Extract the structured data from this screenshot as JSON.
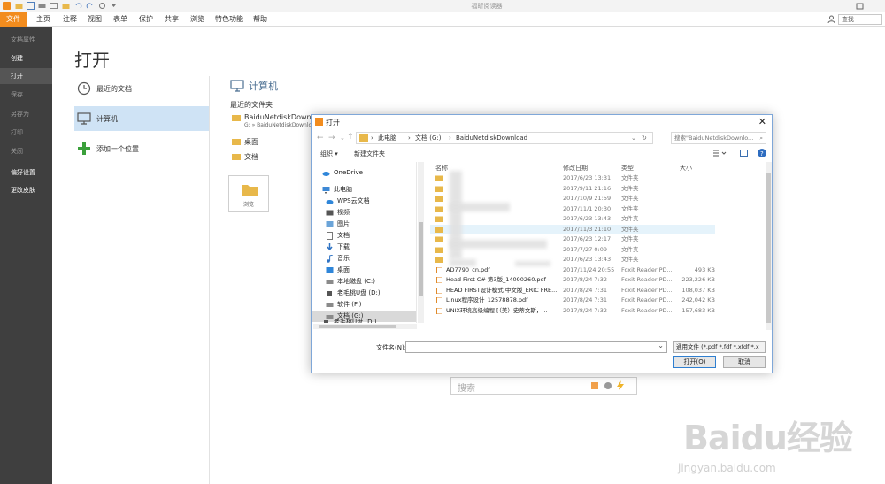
{
  "app": {
    "title": "福昕阅读器",
    "menu": [
      "文件",
      "主页",
      "注释",
      "视图",
      "表单",
      "保护",
      "共享",
      "浏览",
      "特色功能",
      "帮助"
    ],
    "search_placeholder": "查找"
  },
  "sidebar": {
    "items": [
      {
        "label": "文档属性",
        "state": "dim"
      },
      {
        "label": "创建",
        "state": "on"
      },
      {
        "label": "打开",
        "state": "selected"
      },
      {
        "label": "保存",
        "state": "dim"
      },
      {
        "label": "另存为",
        "state": "dim"
      },
      {
        "label": "打印",
        "state": "dim"
      },
      {
        "label": "关闭",
        "state": "dim"
      },
      {
        "label": "偏好设置",
        "state": "on"
      },
      {
        "label": "更改皮肤",
        "state": "on"
      }
    ]
  },
  "open_panel": {
    "title": "打开",
    "options": [
      "最近的文档",
      "计算机",
      "添加一个位置"
    ],
    "computer_heading": "计算机",
    "recent_folders_label": "最近的文件夹",
    "folders": [
      {
        "name": "BaiduNetdiskDownload",
        "sub": "G: » BaiduNetdiskDownlo"
      },
      {
        "name": "桌面"
      },
      {
        "name": "文档"
      }
    ],
    "browse_label": "浏览",
    "bottom_search_placeholder": "搜索"
  },
  "dialog": {
    "title": "打开",
    "path": [
      "此电脑",
      "文档 (G:)",
      "BaiduNetdiskDownload"
    ],
    "search_placeholder": "搜索\"BaiduNetdiskDownlo...",
    "toolbar": {
      "organize": "组织 ▾",
      "new_folder": "新建文件夹"
    },
    "nav_tree": [
      {
        "label": "OneDrive",
        "icon": "cloud-icon",
        "indent": 0
      },
      {
        "label": "此电脑",
        "icon": "computer-icon",
        "indent": 0
      },
      {
        "label": "WPS云文档",
        "icon": "cloud-icon",
        "indent": 1
      },
      {
        "label": "视频",
        "icon": "video-icon",
        "indent": 1
      },
      {
        "label": "图片",
        "icon": "image-icon",
        "indent": 1
      },
      {
        "label": "文档",
        "icon": "document-icon",
        "indent": 1
      },
      {
        "label": "下载",
        "icon": "download-icon",
        "indent": 1
      },
      {
        "label": "音乐",
        "icon": "music-icon",
        "indent": 1
      },
      {
        "label": "桌面",
        "icon": "desktop-icon",
        "indent": 1
      },
      {
        "label": "本地磁盘 (C:)",
        "icon": "drive-icon",
        "indent": 1
      },
      {
        "label": "老毛桃U盘 (D:)",
        "icon": "usb-icon",
        "indent": 1
      },
      {
        "label": "软件 (F:)",
        "icon": "drive-icon",
        "indent": 1
      },
      {
        "label": "文档 (G:)",
        "icon": "drive-icon",
        "indent": 1,
        "selected": true
      },
      {
        "label": "老毛桃U盘 (D:)",
        "icon": "usb-icon",
        "indent": 0
      }
    ],
    "columns": [
      "名称",
      "修改日期",
      "类型",
      "大小"
    ],
    "files": [
      {
        "name": "",
        "date": "2017/6/23 13:31",
        "type": "文件夹",
        "size": "",
        "kind": "folder"
      },
      {
        "name": "",
        "date": "2017/9/11 21:16",
        "type": "文件夹",
        "size": "",
        "kind": "folder"
      },
      {
        "name": "",
        "date": "2017/10/9 21:59",
        "type": "文件夹",
        "size": "",
        "kind": "folder"
      },
      {
        "name": "",
        "date": "2017/11/1 20:30",
        "type": "文件夹",
        "size": "",
        "kind": "folder"
      },
      {
        "name": "",
        "date": "2017/6/23 13:43",
        "type": "文件夹",
        "size": "",
        "kind": "folder"
      },
      {
        "name": "",
        "date": "2017/11/3 21:10",
        "type": "文件夹",
        "size": "",
        "kind": "folder",
        "highlight": true
      },
      {
        "name": "",
        "date": "2017/6/23 12:17",
        "type": "文件夹",
        "size": "",
        "kind": "folder"
      },
      {
        "name": "",
        "date": "2017/7/27 0:09",
        "type": "文件夹",
        "size": "",
        "kind": "folder"
      },
      {
        "name": "",
        "date": "2017/6/23 13:43",
        "type": "文件夹",
        "size": "",
        "kind": "folder"
      },
      {
        "name": "AD7790_cn.pdf",
        "date": "2017/11/24 20:55",
        "type": "Foxit Reader PD...",
        "size": "493 KB",
        "kind": "pdf"
      },
      {
        "name": "Head First C# 第3版_14090260.pdf",
        "date": "2017/8/24 7:32",
        "type": "Foxit Reader PD...",
        "size": "223,226 KB",
        "kind": "pdf"
      },
      {
        "name": "HEAD FIRST设计模式 中文版_ERIC FRE...",
        "date": "2017/8/24 7:31",
        "type": "Foxit Reader PD...",
        "size": "108,037 KB",
        "kind": "pdf"
      },
      {
        "name": "Linux程序设计_12578878.pdf",
        "date": "2017/8/24 7:31",
        "type": "Foxit Reader PD...",
        "size": "242,042 KB",
        "kind": "pdf"
      },
      {
        "name": "UNIX环境高级编程 [（美）史蒂文斯，...",
        "date": "2017/8/24 7:32",
        "type": "Foxit Reader PD...",
        "size": "157,683 KB",
        "kind": "pdf"
      }
    ],
    "filename_label": "文件名(N):",
    "filename_value": "",
    "type_filter": "通用文件 (*.pdf *.fdf *.xfdf *.x",
    "open_button": "打开(O)",
    "cancel_button": "取消"
  },
  "watermark": {
    "text": "Baidu经验",
    "url": "jingyan.baidu.com"
  }
}
